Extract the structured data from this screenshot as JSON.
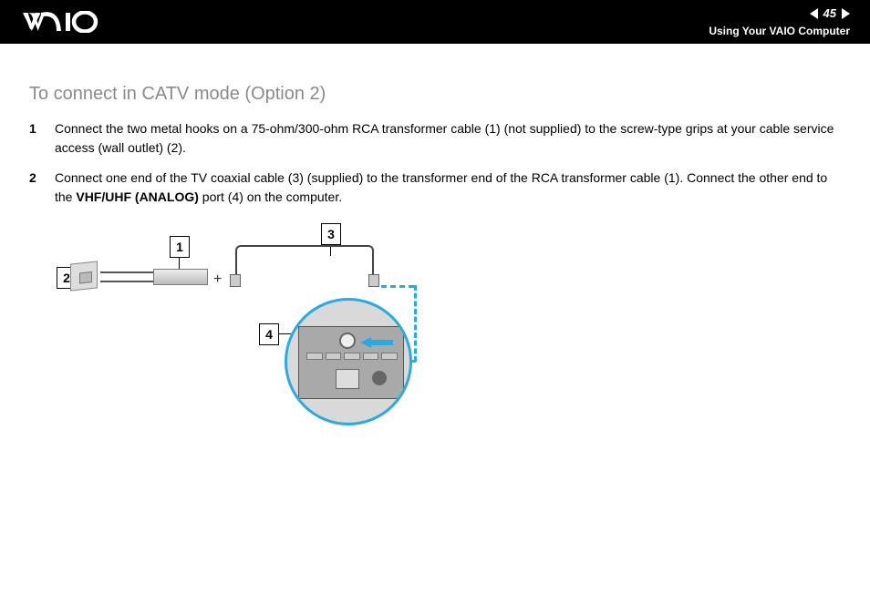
{
  "header": {
    "page_number": "45",
    "section": "Using Your VAIO Computer"
  },
  "content": {
    "heading": "To connect in CATV mode (Option 2)",
    "steps": [
      {
        "num": "1",
        "text_a": "Connect the two metal hooks on a 75-ohm/300-ohm RCA transformer cable (1) (not supplied) to the screw-type grips at your cable service access (wall outlet) (2)."
      },
      {
        "num": "2",
        "text_a": "Connect one end of the TV coaxial cable (3) (supplied) to the transformer end of the RCA transformer cable (1). Connect the other end to the ",
        "bold": "VHF/UHF (ANALOG)",
        "text_b": " port (4) on the computer."
      }
    ]
  },
  "diagram": {
    "callouts": {
      "c1": "1",
      "c2": "2",
      "c3": "3",
      "c4": "4"
    }
  }
}
